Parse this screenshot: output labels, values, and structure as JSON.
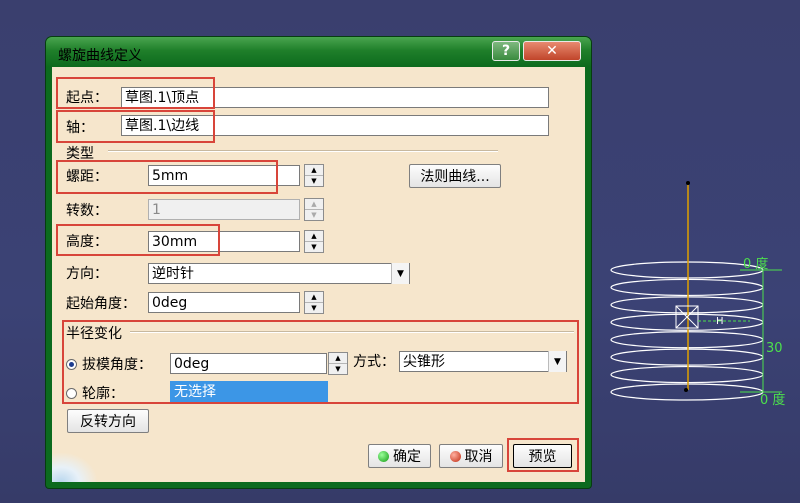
{
  "dialog": {
    "title": "螺旋曲线定义",
    "help_label": "?",
    "close_label": "✕"
  },
  "form": {
    "start_point": {
      "label": "起点：",
      "value": "草图.1\\顶点"
    },
    "axis": {
      "label": "轴：",
      "value": "草图.1\\边线"
    },
    "type_group": {
      "label": "类型"
    },
    "pitch": {
      "label": "螺距：",
      "value": "5mm"
    },
    "law_curve_button": "法则曲线...",
    "turns": {
      "label": "转数：",
      "value": "1"
    },
    "height": {
      "label": "高度：",
      "value": "30mm"
    },
    "orientation": {
      "label": "方向：",
      "value": "逆时针"
    },
    "start_angle": {
      "label": "起始角度：",
      "value": "0deg"
    },
    "radius_variation": {
      "label": "半径变化",
      "taper_angle": {
        "label": "拔模角度：",
        "value": "0deg",
        "selected": true
      },
      "way": {
        "label": "方式：",
        "value": "尖锥形"
      },
      "profile": {
        "label": "轮廓：",
        "value": "无选择",
        "selected": false
      }
    },
    "reverse_direction_button": "反转方向"
  },
  "footer": {
    "ok_label": "确定",
    "cancel_label": "取消",
    "preview_label": "预览"
  },
  "viewport": {
    "top_angle_label": "0 度",
    "height_dim_label": "30",
    "bottom_angle_label": "0 度",
    "axis_marker_label": "H"
  },
  "colors": {
    "title_bar": "#1f7f2a",
    "client_bg": "#f6e6cc",
    "highlight_box": "#d8453a",
    "selection": "#3c96e6",
    "helix_stroke": "#ffffff",
    "axis_stroke": "#e0a000",
    "dimension_green": "#4ce04c"
  },
  "icons": {
    "ok": "green-dot-icon",
    "cancel": "red-dot-icon"
  }
}
